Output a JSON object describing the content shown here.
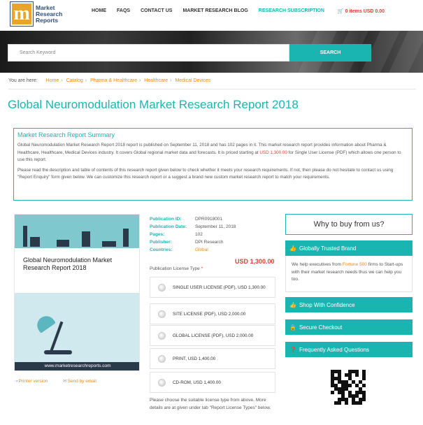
{
  "brand": {
    "line1": "Market",
    "line2": "Research",
    "line3": "Reports",
    "colors": {
      "accent": "#1ab5b0",
      "orange": "#e88b1a",
      "red": "#e03c31",
      "logo": "#e8a52c"
    }
  },
  "nav": {
    "home": "HOME",
    "faqs": "FAQS",
    "contact": "CONTACT US",
    "blog": "MARKET RESEARCH BLOG",
    "subscription": "RESEARCH SUBSCRIPTION",
    "cart": "0 items USD 0.00"
  },
  "search": {
    "placeholder": "Search Keyword",
    "button": "SEARCH"
  },
  "breadcrumb": {
    "prefix": "You are here:",
    "items": [
      "Home",
      "Catalog",
      "Pharma & Healthcare",
      "Healthcare",
      "Medical Devices"
    ]
  },
  "title": "Global Neuromodulation Market Research Report 2018",
  "summary": {
    "heading": "Market Research Report Summary",
    "p1_a": "Global Neuromodulation Market Research Report 2018 report is published on September 11, 2018 and has 102 pages in it. This market research report provides information about Pharma & Healthcare, Healthcare, Medical Devices industry. It covers Global regional market data and forecasts. It is priced starting at ",
    "p1_price": "USD 1,300.00",
    "p1_b": " for Single User License (PDF) which allows one person to use this report.",
    "p2": "Please read the description and table of contents of this research report given below to check whether it meets your research requirements. If not, then please do not hesitate to contact us using \"Report Enquiry\" form given below. We can customize this research report or a suggest a brand new custom market research report to match your requirements."
  },
  "cover": {
    "title": "Global Neuromodulation Market Research Report 2018",
    "url": "www.marketresearchreports.com"
  },
  "links": {
    "print": "Printer version",
    "email": "Send by email"
  },
  "meta": {
    "id_label": "Publication ID:",
    "id": "DPR0918001",
    "date_label": "Publication Date:",
    "date": "September 11, 2018",
    "pages_label": "Pages:",
    "pages": "102",
    "publisher_label": "Publisher:",
    "publisher": "DPI Research",
    "countries_label": "Countries:",
    "countries": "Global"
  },
  "price": "USD 1,300.00",
  "license": {
    "label": "Publication License Type",
    "required": "*",
    "options": [
      "SINGLE USER LICENSE (PDF), USD 1,300.00",
      "SITE LICENSE (PDF), USD 2,000.00",
      "GLOBAL LICENSE (PDF), USD 2,000.00",
      "PRINT, USD 1,400.00",
      "CD-ROM, USD 1,400.00"
    ],
    "note": "Please choose the suitable license type from above. More details are at given under tab \"Report License Types\" below."
  },
  "sidebar": {
    "why": "Why to buy from us?",
    "trusted": "Globally Trusted Brand",
    "trusted_a": "We help executives from ",
    "trusted_hl": "Fortune 500",
    "trusted_b": " firms to Start-ups with their market research needs thus we can help you too.",
    "confidence": "Shop With Confidence",
    "checkout": "Secure Checkout",
    "faq": "Frequently Asked Questions"
  }
}
